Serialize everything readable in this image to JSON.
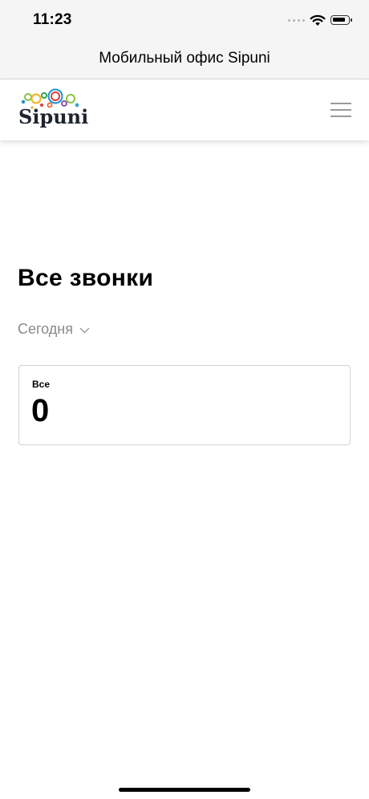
{
  "status_bar": {
    "time": "11:23",
    "icons": [
      "signal-dots-icon",
      "wifi-icon",
      "battery-icon"
    ]
  },
  "window": {
    "title": "Мобильный офис Sipuni"
  },
  "header": {
    "logo_text": "Sipuni",
    "menu_icon": "hamburger-menu-icon"
  },
  "main": {
    "title": "Все звонки",
    "period_selector": {
      "selected": "Сегодня",
      "icon": "chevron-down-icon"
    },
    "stats": [
      {
        "label": "Все",
        "value": "0"
      }
    ]
  },
  "colors": {
    "logo_rings": [
      "#e23b3b",
      "#f2b21a",
      "#2aa84a",
      "#1e8fd0",
      "#8a3fb0",
      "#e86a2a",
      "#86c440",
      "#3aa7c9"
    ],
    "muted_text": "#8a8a8a",
    "card_border": "#d2d2d2"
  }
}
